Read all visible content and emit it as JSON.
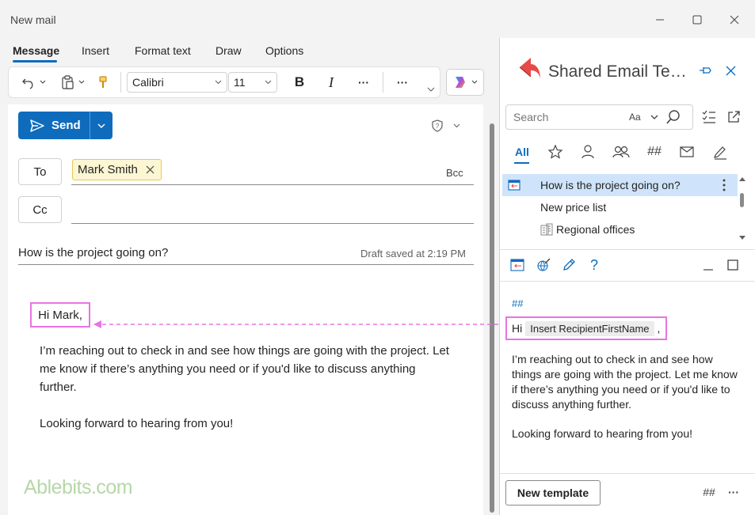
{
  "window": {
    "title": "New mail"
  },
  "ribbon": {
    "tabs": [
      "Message",
      "Insert",
      "Format text",
      "Draw",
      "Options"
    ]
  },
  "toolbar": {
    "font_name": "Calibri",
    "font_size": "11",
    "bold": "B",
    "italic": "I",
    "more1": "···",
    "more2": "···"
  },
  "compose": {
    "send_label": "Send",
    "to_label": "To",
    "cc_label": "Cc",
    "bcc_label": "Bcc",
    "recipient": "Mark Smith",
    "subject": "How is the project going on?",
    "draft_status": "Draft saved at 2:19 PM",
    "greeting": "Hi Mark,",
    "body": "I’m reaching out to check in and see how things are going with the project. Let me know if there’s anything you need or if you'd like to discuss anything further.",
    "closing": "Looking forward to hearing from you!"
  },
  "watermark": "Ablebits.com",
  "pane": {
    "title": "Shared Email Templates",
    "search_placeholder": "Search",
    "match_case": "Aa",
    "filter_all": "All",
    "hash_tab": "##",
    "templates": [
      {
        "label": "How is the project going on?",
        "selected": true
      },
      {
        "label": "New price list",
        "selected": false
      },
      {
        "label": "Regional offices",
        "selected": false
      }
    ],
    "help": "?",
    "preview": {
      "hashes": "##",
      "hi": "Hi",
      "macro": "Insert RecipientFirstName",
      "comma": ",",
      "body": "I’m reaching out to check in and see how things are going with the project. Let me know if there’s anything you need or if you'd like to discuss anything further.",
      "closing": "Looking forward to hearing from you!"
    },
    "new_template_label": "New template",
    "footer_hash": "##",
    "footer_more": "···"
  },
  "colors": {
    "accent": "#0f6cbd",
    "highlight": "#e874e3",
    "selected_row": "#cfe4fa",
    "recipient_bg": "#fdf6d3"
  }
}
